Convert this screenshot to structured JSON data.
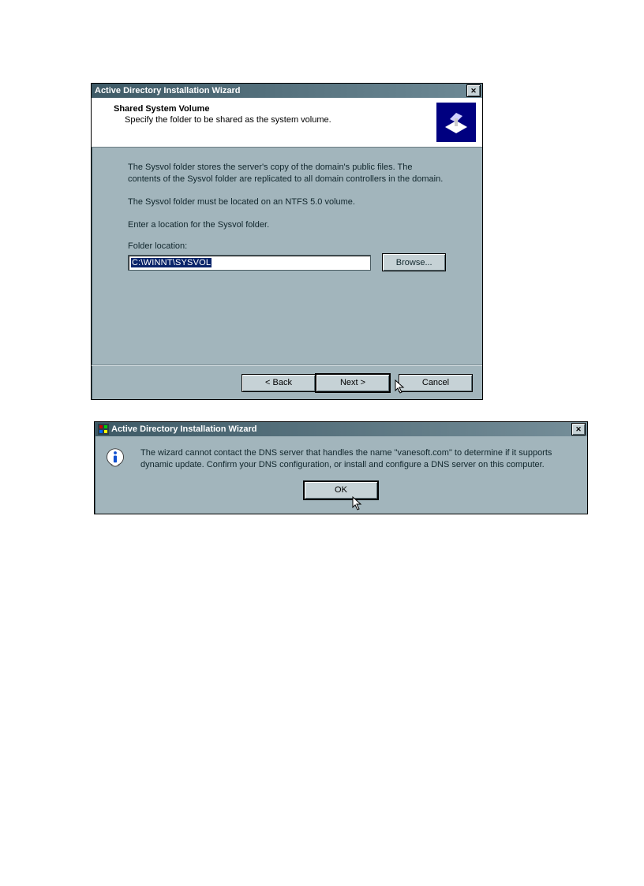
{
  "wizard": {
    "title": "Active Directory Installation Wizard",
    "header_title": "Shared System Volume",
    "header_subtitle": "Specify the folder to be shared as the system volume.",
    "para1": "The Sysvol folder stores the server's copy of the domain's public files. The contents of the Sysvol folder are replicated to all domain controllers in the domain.",
    "para2": "The Sysvol folder must be located on an NTFS 5.0 volume.",
    "para3": "Enter a location for the Sysvol folder.",
    "field_label": "Folder location:",
    "field_value": "C:\\WINNT\\SYSVOL",
    "browse_label": "Browse...",
    "back_label": "< Back",
    "next_label": "Next >",
    "cancel_label": "Cancel",
    "close_glyph": "✕"
  },
  "msgbox": {
    "title": "Active Directory Installation Wizard",
    "text": "The wizard cannot contact the DNS server that handles the name \"vanesoft.com\" to determine if it supports dynamic update. Confirm your DNS configuration, or install and configure a DNS server on this computer.",
    "ok_label": "OK",
    "close_glyph": "✕"
  }
}
